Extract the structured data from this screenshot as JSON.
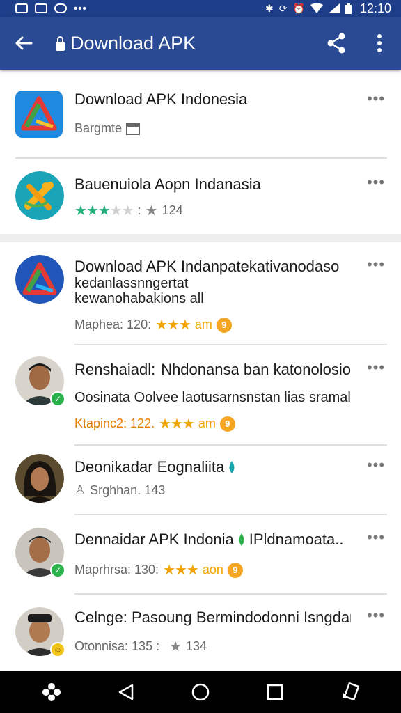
{
  "status_bar": {
    "time": "12:10",
    "left_icons": [
      "gallery-icon",
      "chat-icon",
      "messenger-icon"
    ],
    "left_more": "•••",
    "right_icons": [
      "bluetooth-icon",
      "sync-icon",
      "alarm-icon",
      "wifi-icon",
      "signal-icon",
      "battery-icon"
    ]
  },
  "app_bar": {
    "title": "Download APK",
    "back_icon": "arrow-left-icon",
    "lock_icon": "lock-icon",
    "share_icon": "share-icon",
    "menu_icon": "more-vert-icon"
  },
  "items": [
    {
      "title": "Download APK Indonesia",
      "meta_text": "Bargmte",
      "icon": "app-logo-icon",
      "more": "•••"
    },
    {
      "title": "Bauenuiola Aopn Indanasia",
      "rating": 3,
      "meta_sep": ":",
      "meta_count": "124",
      "icon": "app-logo-icon",
      "more": "•••"
    },
    {
      "title": "Download APK Indanpatekativanodaso",
      "line2": "kedanlassnngertat",
      "line3": "kewanohabakions all",
      "meta_label": "Maphea: 120:",
      "meta_suffix": "am",
      "icon": "app-logo-icon",
      "more": "•••"
    },
    {
      "title": "Renshaiadl:",
      "title_after": "Nhdonansa ban katonolosio...",
      "line2": "Oosinata Oolvee laotusarnsnstan lias sramal",
      "meta_label": "Ktapinc2: 122.",
      "meta_suffix": "am",
      "icon": "avatar-icon",
      "more": "•••"
    },
    {
      "title": "Deonikadar Eognaliita",
      "meta_text": "Srghhan. 143",
      "icon": "avatar-icon",
      "more": "•••"
    },
    {
      "title": "Dennaidar APK Indonia",
      "title_after": "IPldnamoata..",
      "meta_label": "Maprhrsa: 130:",
      "meta_suffix": "aon",
      "icon": "avatar-icon",
      "more": "•••"
    },
    {
      "title": "Celnge: Pasoung Bermindodonni Isngdannd",
      "meta_label": "Otonnisa: 135 :",
      "meta_count": "134",
      "icon": "avatar-icon",
      "more": "•••"
    }
  ],
  "colors": {
    "status_bar": "#1e3e8a",
    "app_bar": "#2a4a93",
    "green_star": "#21b07a",
    "orange_star": "#f0a400",
    "nav_bar": "#000000"
  },
  "nav_bar": [
    "assistant-icon",
    "back-triangle-icon",
    "home-circle-icon",
    "recents-square-icon",
    "rotate-icon"
  ]
}
